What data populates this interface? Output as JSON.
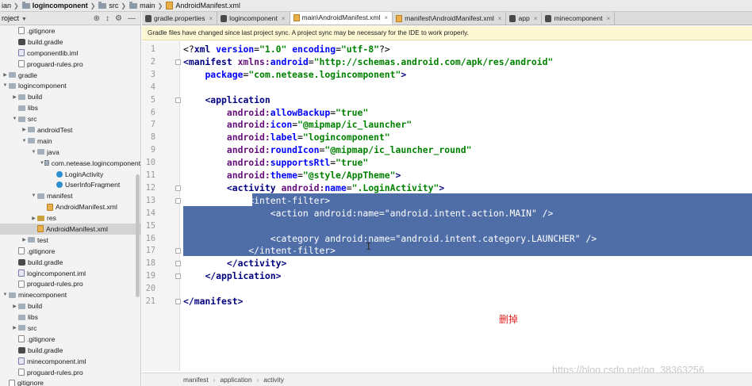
{
  "nav": {
    "crumbs": [
      "ian",
      "logincomponent",
      "src",
      "main",
      "AndroidManifest.xml"
    ]
  },
  "project": {
    "title": "roject",
    "tools": [
      "⊕",
      "↕",
      "⚙",
      "—"
    ],
    "tree": [
      {
        "label": ".gitignore",
        "icon": "file-icon",
        "indent": 1,
        "arrow": ""
      },
      {
        "label": "build.gradle",
        "icon": "gradle-icon",
        "indent": 1,
        "arrow": ""
      },
      {
        "label": "componentlib.iml",
        "icon": "iml-icon",
        "indent": 1,
        "arrow": ""
      },
      {
        "label": "proguard-rules.pro",
        "icon": "file-icon",
        "indent": 1,
        "arrow": ""
      },
      {
        "label": "gradle",
        "icon": "folder-icon",
        "indent": 0,
        "arrow": "▶"
      },
      {
        "label": "logincomponent",
        "icon": "folder-icon",
        "indent": 0,
        "arrow": "▼"
      },
      {
        "label": "build",
        "icon": "folder-icon",
        "indent": 1,
        "arrow": "▶"
      },
      {
        "label": "libs",
        "icon": "folder-icon",
        "indent": 1,
        "arrow": ""
      },
      {
        "label": "src",
        "icon": "folder-icon",
        "indent": 1,
        "arrow": "▼"
      },
      {
        "label": "androidTest",
        "icon": "folder-icon",
        "indent": 2,
        "arrow": "▶"
      },
      {
        "label": "main",
        "icon": "folder-icon",
        "indent": 2,
        "arrow": "▼"
      },
      {
        "label": "java",
        "icon": "folder-icon",
        "indent": 3,
        "arrow": "▼"
      },
      {
        "label": "com.netease.logincomponent",
        "icon": "package-icon",
        "indent": 4,
        "arrow": "▼"
      },
      {
        "label": "LoginActivity",
        "icon": "java-class-icon",
        "indent": 5,
        "arrow": ""
      },
      {
        "label": "UserInfoFragment",
        "icon": "java-class-icon",
        "indent": 5,
        "arrow": ""
      },
      {
        "label": "manifest",
        "icon": "folder-icon",
        "indent": 3,
        "arrow": "▼"
      },
      {
        "label": "AndroidManifest.xml",
        "icon": "xml-icon",
        "indent": 4,
        "arrow": ""
      },
      {
        "label": "res",
        "icon": "res-folder-icon",
        "indent": 3,
        "arrow": "▶"
      },
      {
        "label": "AndroidManifest.xml",
        "icon": "xml-icon",
        "indent": 3,
        "arrow": "",
        "selected": true
      },
      {
        "label": "test",
        "icon": "folder-icon",
        "indent": 2,
        "arrow": "▶"
      },
      {
        "label": ".gitignore",
        "icon": "file-icon",
        "indent": 1,
        "arrow": ""
      },
      {
        "label": "build.gradle",
        "icon": "gradle-icon",
        "indent": 1,
        "arrow": ""
      },
      {
        "label": "logincomponent.iml",
        "icon": "iml-icon",
        "indent": 1,
        "arrow": ""
      },
      {
        "label": "proguard-rules.pro",
        "icon": "file-icon",
        "indent": 1,
        "arrow": ""
      },
      {
        "label": "minecomponent",
        "icon": "folder-icon",
        "indent": 0,
        "arrow": "▼"
      },
      {
        "label": "build",
        "icon": "folder-icon",
        "indent": 1,
        "arrow": "▶"
      },
      {
        "label": "libs",
        "icon": "folder-icon",
        "indent": 1,
        "arrow": ""
      },
      {
        "label": "src",
        "icon": "folder-icon",
        "indent": 1,
        "arrow": "▶"
      },
      {
        "label": ".gitignore",
        "icon": "file-icon",
        "indent": 1,
        "arrow": ""
      },
      {
        "label": "build.gradle",
        "icon": "gradle-icon",
        "indent": 1,
        "arrow": ""
      },
      {
        "label": "minecomponent.iml",
        "icon": "iml-icon",
        "indent": 1,
        "arrow": ""
      },
      {
        "label": "proguard-rules.pro",
        "icon": "file-icon",
        "indent": 1,
        "arrow": ""
      },
      {
        "label": "gitignore",
        "icon": "file-icon",
        "indent": 0,
        "arrow": ""
      }
    ]
  },
  "tabs": [
    {
      "label": "gradle.properties",
      "icon": "gradle-icon",
      "active": false
    },
    {
      "label": "logincomponent",
      "icon": "gradle-icon",
      "active": false
    },
    {
      "label": "main\\AndroidManifest.xml",
      "icon": "xml-icon",
      "active": true
    },
    {
      "label": "manifest\\AndroidManifest.xml",
      "icon": "xml-icon",
      "active": false
    },
    {
      "label": "app",
      "icon": "gradle-icon",
      "active": false
    },
    {
      "label": "minecomponent",
      "icon": "gradle-icon",
      "active": false
    }
  ],
  "notice": {
    "text": "Gradle files have changed since last project sync. A project sync may be necessary for the IDE to work properly."
  },
  "editor": {
    "lines": [
      {
        "n": "1",
        "segs": [
          [
            "p",
            "<?"
          ],
          [
            "tag",
            "xml "
          ],
          [
            "attr",
            "version"
          ],
          [
            "p",
            "="
          ],
          [
            "val",
            "\"1.0\""
          ],
          [
            "p",
            " "
          ],
          [
            "attr",
            "encoding"
          ],
          [
            "p",
            "="
          ],
          [
            "val",
            "\"utf-8\""
          ],
          [
            "p",
            "?>"
          ]
        ]
      },
      {
        "n": "2",
        "segs": [
          [
            "tag",
            "<manifest "
          ],
          [
            "ns",
            "xmlns:"
          ],
          [
            "attr",
            "android"
          ],
          [
            "p",
            "="
          ],
          [
            "val",
            "\"http://schemas.android.com/apk/res/android\""
          ]
        ]
      },
      {
        "n": "3",
        "segs": [
          [
            "p",
            "    "
          ],
          [
            "attr",
            "package"
          ],
          [
            "p",
            "="
          ],
          [
            "val",
            "\"com.netease.logincomponent\""
          ],
          [
            "tag",
            ">"
          ]
        ]
      },
      {
        "n": "4",
        "segs": []
      },
      {
        "n": "5",
        "segs": [
          [
            "p",
            "    "
          ],
          [
            "tag",
            "<application"
          ]
        ]
      },
      {
        "n": "6",
        "segs": [
          [
            "p",
            "        "
          ],
          [
            "ns",
            "android:"
          ],
          [
            "attr",
            "allowBackup"
          ],
          [
            "p",
            "="
          ],
          [
            "val",
            "\"true\""
          ]
        ]
      },
      {
        "n": "7",
        "segs": [
          [
            "p",
            "        "
          ],
          [
            "ns",
            "android:"
          ],
          [
            "attr",
            "icon"
          ],
          [
            "p",
            "="
          ],
          [
            "val",
            "\"@mipmap/ic_launcher\""
          ]
        ]
      },
      {
        "n": "8",
        "segs": [
          [
            "p",
            "        "
          ],
          [
            "ns",
            "android:"
          ],
          [
            "attr",
            "label"
          ],
          [
            "p",
            "="
          ],
          [
            "val",
            "\"logincomponent\""
          ]
        ]
      },
      {
        "n": "9",
        "segs": [
          [
            "p",
            "        "
          ],
          [
            "ns",
            "android:"
          ],
          [
            "attr",
            "roundIcon"
          ],
          [
            "p",
            "="
          ],
          [
            "val",
            "\"@mipmap/ic_launcher_round\""
          ]
        ]
      },
      {
        "n": "10",
        "segs": [
          [
            "p",
            "        "
          ],
          [
            "ns",
            "android:"
          ],
          [
            "attr",
            "supportsRtl"
          ],
          [
            "p",
            "="
          ],
          [
            "val",
            "\"true\""
          ]
        ]
      },
      {
        "n": "11",
        "segs": [
          [
            "p",
            "        "
          ],
          [
            "ns",
            "android:"
          ],
          [
            "attr",
            "theme"
          ],
          [
            "p",
            "="
          ],
          [
            "val",
            "\"@style/AppTheme\""
          ],
          [
            "tag",
            ">"
          ]
        ]
      },
      {
        "n": "12",
        "segs": [
          [
            "p",
            "        "
          ],
          [
            "tag",
            "<activity "
          ],
          [
            "ns",
            "android:"
          ],
          [
            "attr",
            "name"
          ],
          [
            "p",
            "="
          ],
          [
            "val",
            "\".LoginActivity\""
          ],
          [
            "tag",
            ">"
          ]
        ]
      },
      {
        "n": "13",
        "hl": true,
        "segs": [
          [
            "p",
            "            "
          ],
          [
            "tag",
            "<intent-filter>"
          ]
        ]
      },
      {
        "n": "14",
        "hl": true,
        "segs": [
          [
            "p",
            "                "
          ],
          [
            "tag",
            "<action "
          ],
          [
            "ns",
            "android:"
          ],
          [
            "attr",
            "name"
          ],
          [
            "p",
            "="
          ],
          [
            "val",
            "\"android.intent.action.MAIN\""
          ],
          [
            "tag",
            " />"
          ]
        ]
      },
      {
        "n": "15",
        "hl": true,
        "segs": []
      },
      {
        "n": "16",
        "hl": true,
        "segs": [
          [
            "p",
            "                "
          ],
          [
            "tag",
            "<category "
          ],
          [
            "ns",
            "android:"
          ],
          [
            "attr",
            "name"
          ],
          [
            "p",
            "="
          ],
          [
            "val",
            "\"android.intent.category.LAUNCHER\""
          ],
          [
            "tag",
            " />"
          ]
        ]
      },
      {
        "n": "17",
        "hl": true,
        "segs": [
          [
            "p",
            "            "
          ],
          [
            "tag",
            "</intent-filter>"
          ]
        ]
      },
      {
        "n": "18",
        "segs": [
          [
            "p",
            "        "
          ],
          [
            "tag",
            "</activity>"
          ]
        ]
      },
      {
        "n": "19",
        "segs": [
          [
            "p",
            "    "
          ],
          [
            "tag",
            "</application>"
          ]
        ]
      },
      {
        "n": "20",
        "segs": []
      },
      {
        "n": "21",
        "segs": [
          [
            "tag",
            "</manifest>"
          ]
        ]
      }
    ],
    "annotation": "删掉",
    "cursor": "I",
    "watermark": "https://blog.csdn.net/qq_38363256"
  },
  "statusbar": {
    "crumbs": [
      "manifest",
      "application",
      "activity"
    ]
  },
  "colors": {
    "selection": "#4f6ea8",
    "tag": "#000080",
    "attr": "#0000ff",
    "value": "#008000",
    "annotation": "#e02020"
  }
}
